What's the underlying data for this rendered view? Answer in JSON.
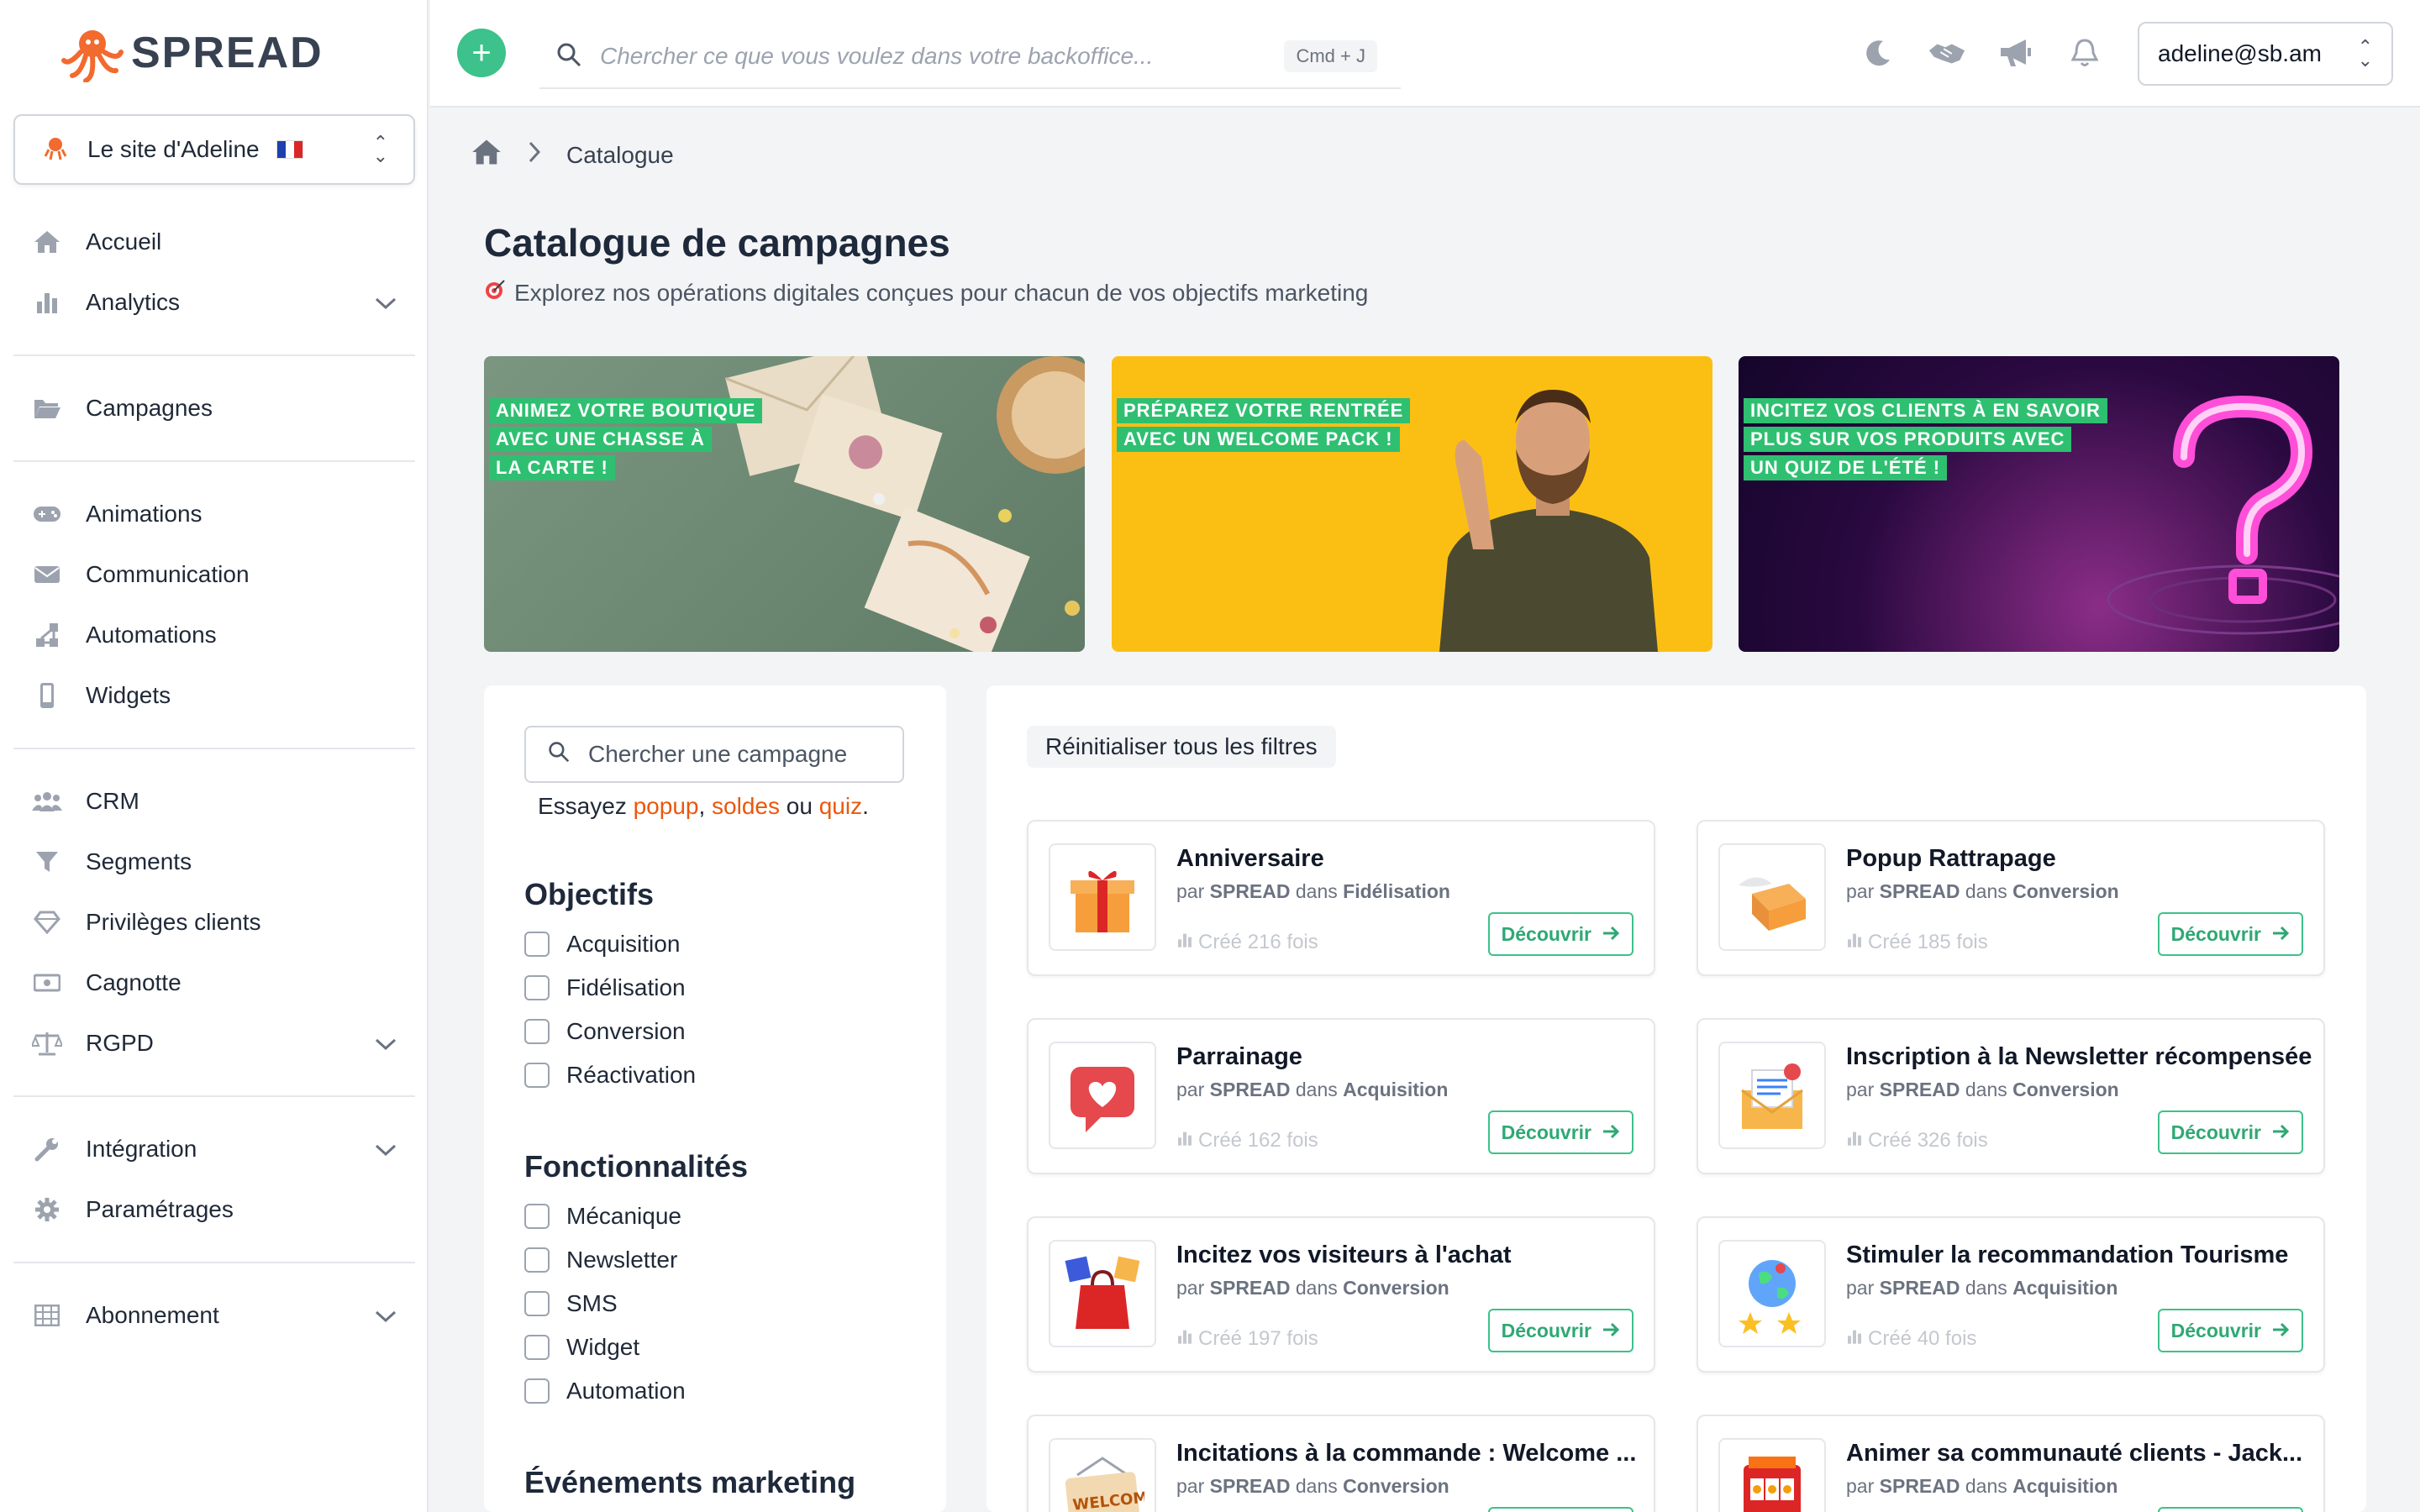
{
  "brand": {
    "name": "SPREAD",
    "accent": "#3cc28a",
    "logo_color": "#f26a2e"
  },
  "site_selector": {
    "name": "Le site d'Adeline",
    "flag": "france-flag-icon"
  },
  "sidebar": {
    "items": [
      {
        "label": "Accueil",
        "icon": "home-icon",
        "expandable": false
      },
      {
        "label": "Analytics",
        "icon": "bar-chart-icon",
        "expandable": true
      },
      {
        "label": "Campagnes",
        "icon": "folder-icon",
        "expandable": false
      },
      {
        "label": "Animations",
        "icon": "gamepad-icon",
        "expandable": false
      },
      {
        "label": "Communication",
        "icon": "envelope-icon",
        "expandable": false
      },
      {
        "label": "Automations",
        "icon": "automation-icon",
        "expandable": false
      },
      {
        "label": "Widgets",
        "icon": "mobile-icon",
        "expandable": false
      },
      {
        "label": "CRM",
        "icon": "users-icon",
        "expandable": false
      },
      {
        "label": "Segments",
        "icon": "filter-icon",
        "expandable": false
      },
      {
        "label": "Privilèges clients",
        "icon": "gem-icon",
        "expandable": false
      },
      {
        "label": "Cagnotte",
        "icon": "money-icon",
        "expandable": false
      },
      {
        "label": "RGPD",
        "icon": "scale-icon",
        "expandable": true
      },
      {
        "label": "Intégration",
        "icon": "wrench-icon",
        "expandable": true
      },
      {
        "label": "Paramétrages",
        "icon": "gear-icon",
        "expandable": false
      },
      {
        "label": "Abonnement",
        "icon": "table-icon",
        "expandable": true
      }
    ]
  },
  "topbar": {
    "search_placeholder": "Chercher ce que vous voulez dans votre backoffice...",
    "shortcut": "Cmd + J",
    "user": "adeline@sb.am",
    "icons": [
      "moon-icon",
      "handshake-icon",
      "megaphone-icon",
      "bell-icon"
    ]
  },
  "breadcrumb": {
    "current": "Catalogue"
  },
  "page": {
    "title": "Catalogue de campagnes",
    "subtitle": "Explorez nos opérations digitales conçues pour chacun de vos objectifs marketing"
  },
  "banners": [
    {
      "lines": [
        "ANIMEZ VOTRE BOUTIQUE",
        "AVEC UNE CHASSE À",
        "LA CARTE !"
      ],
      "bg": "#6e8a72"
    },
    {
      "lines": [
        "PRÉPAREZ VOTRE RENTRÉE",
        "AVEC UN WELCOME PACK !"
      ],
      "bg": "#fbbf14"
    },
    {
      "lines": [
        "INCITEZ VOS CLIENTS À EN SAVOIR",
        "PLUS SUR VOS PRODUITS AVEC",
        "UN QUIZ DE L'ÉTÉ !"
      ],
      "bg": "#3b0a4f"
    }
  ],
  "filters": {
    "search_placeholder": "Chercher une campagne",
    "suggest_prefix": "Essayez",
    "suggest_links": [
      "popup",
      "soldes",
      "quiz"
    ],
    "suggest_or": "ou",
    "groups": [
      {
        "title": "Objectifs",
        "options": [
          "Acquisition",
          "Fidélisation",
          "Conversion",
          "Réactivation"
        ]
      },
      {
        "title": "Fonctionnalités",
        "options": [
          "Mécanique",
          "Newsletter",
          "SMS",
          "Widget",
          "Automation"
        ]
      },
      {
        "title": "Événements marketing",
        "options": []
      }
    ]
  },
  "results": {
    "reset_label": "Réinitialiser tous les filtres",
    "by_word": "par",
    "in_word": "dans",
    "discover_label": "Découvrir",
    "cards": [
      {
        "title": "Anniversaire",
        "author": "SPREAD",
        "category": "Fidélisation",
        "stat": "Créé 216 fois",
        "thumb": "gift-icon"
      },
      {
        "title": "Popup Rattrapage",
        "author": "SPREAD",
        "category": "Conversion",
        "stat": "Créé 185 fois",
        "thumb": "flying-box-icon"
      },
      {
        "title": "Parrainage",
        "author": "SPREAD",
        "category": "Acquisition",
        "stat": "Créé 162 fois",
        "thumb": "heart-bubble-icon"
      },
      {
        "title": "Inscription à la Newsletter récompensée",
        "author": "SPREAD",
        "category": "Conversion",
        "stat": "Créé 326 fois",
        "thumb": "envelope-gift-icon"
      },
      {
        "title": "Incitez vos visiteurs à l'achat",
        "author": "SPREAD",
        "category": "Conversion",
        "stat": "Créé 197 fois",
        "thumb": "shopping-bag-icon"
      },
      {
        "title": "Stimuler la recommandation Tourisme",
        "author": "SPREAD",
        "category": "Acquisition",
        "stat": "Créé 40 fois",
        "thumb": "globe-stars-icon"
      },
      {
        "title": "Incitations à la commande : Welcome ...",
        "author": "SPREAD",
        "category": "Conversion",
        "stat": "",
        "thumb": "welcome-sign-icon"
      },
      {
        "title": "Animer sa communauté clients - Jack...",
        "author": "SPREAD",
        "category": "Acquisition",
        "stat": "",
        "thumb": "slot-machine-icon"
      }
    ]
  }
}
